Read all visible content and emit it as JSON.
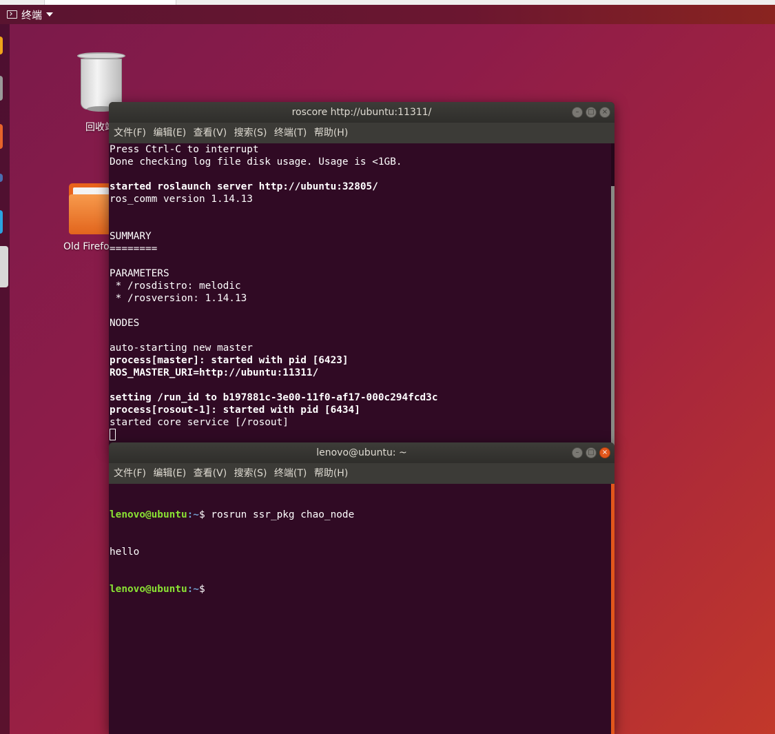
{
  "topbar": {
    "app_name": "终端"
  },
  "desktop": {
    "trash_label": "回收站",
    "folder_label": "Old Firefox Data"
  },
  "menu": [
    "文件(F)",
    "编辑(E)",
    "查看(V)",
    "搜索(S)",
    "终端(T)",
    "帮助(H)"
  ],
  "window_roscore": {
    "title": "roscore http://ubuntu:11311/",
    "lines": [
      {
        "text": "Press Ctrl-C to interrupt",
        "bold": false
      },
      {
        "text": "Done checking log file disk usage. Usage is <1GB.",
        "bold": false
      },
      {
        "text": "",
        "bold": false
      },
      {
        "text": "started roslaunch server http://ubuntu:32805/",
        "bold": true
      },
      {
        "text": "ros_comm version 1.14.13",
        "bold": false
      },
      {
        "text": "",
        "bold": false
      },
      {
        "text": "",
        "bold": false
      },
      {
        "text": "SUMMARY",
        "bold": false
      },
      {
        "text": "========",
        "bold": false
      },
      {
        "text": "",
        "bold": false
      },
      {
        "text": "PARAMETERS",
        "bold": false
      },
      {
        "text": " * /rosdistro: melodic",
        "bold": false
      },
      {
        "text": " * /rosversion: 1.14.13",
        "bold": false
      },
      {
        "text": "",
        "bold": false
      },
      {
        "text": "NODES",
        "bold": false
      },
      {
        "text": "",
        "bold": false
      },
      {
        "text": "auto-starting new master",
        "bold": false
      },
      {
        "text": "process[master]: started with pid [6423]",
        "bold": true
      },
      {
        "text": "ROS_MASTER_URI=http://ubuntu:11311/",
        "bold": true
      },
      {
        "text": "",
        "bold": false
      },
      {
        "text": "setting /run_id to b197881c-3e00-11f0-af17-000c294fcd3c",
        "bold": true
      },
      {
        "text": "process[rosout-1]: started with pid [6434]",
        "bold": true
      },
      {
        "text": "started core service [/rosout]",
        "bold": false
      }
    ]
  },
  "window_shell": {
    "title": "lenovo@ubuntu: ~",
    "prompt_user": "lenovo@ubuntu",
    "prompt_path": ":~",
    "prompt_symbol": "$",
    "command": " rosrun ssr_pkg chao_node",
    "output": "hello"
  },
  "colors": {
    "terminal_bg": "#300a24",
    "prompt_green": "#8ae234",
    "prompt_blue": "#729fcf",
    "accent_orange": "#e2561b"
  }
}
